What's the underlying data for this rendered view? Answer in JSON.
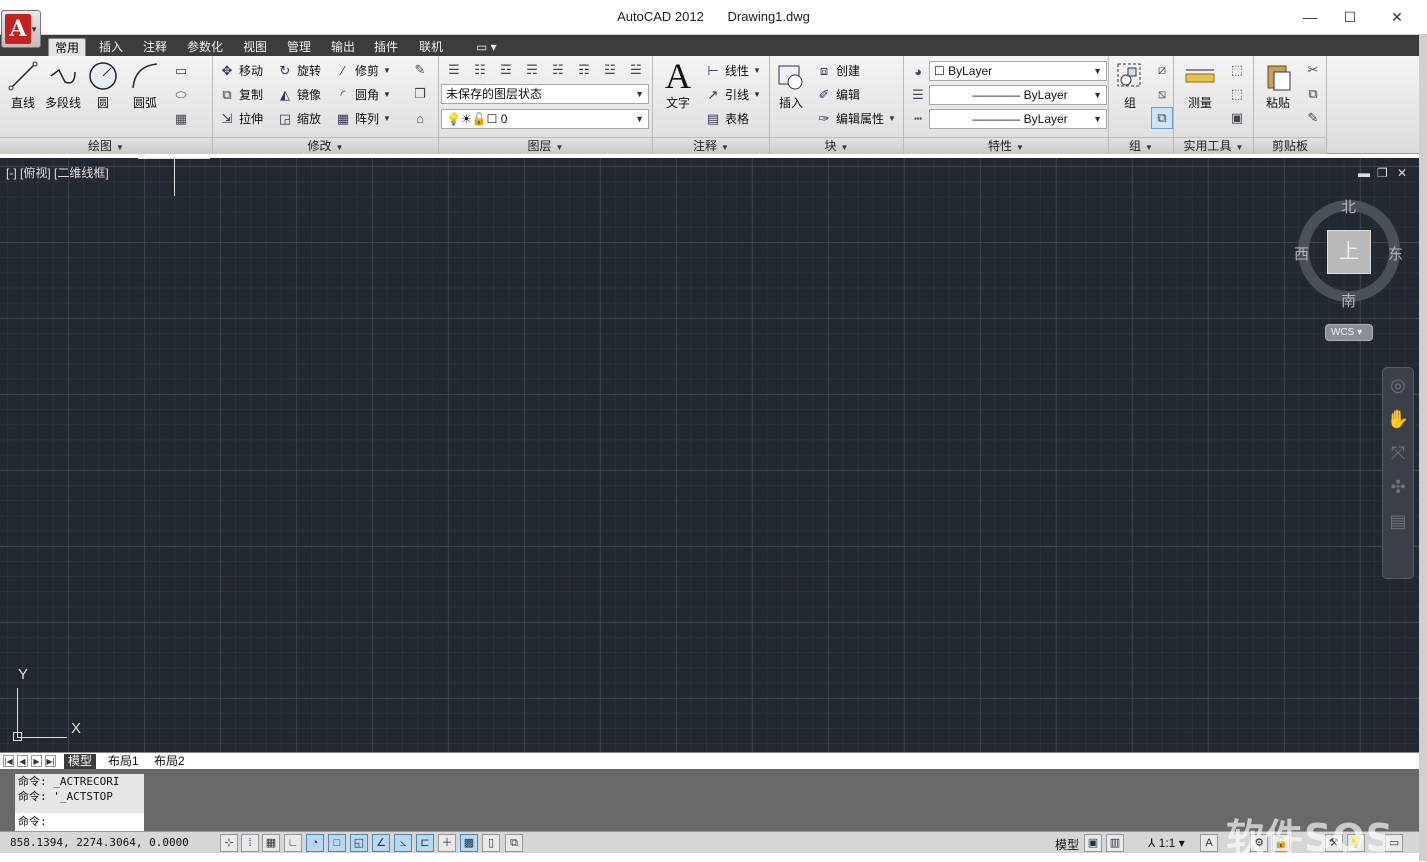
{
  "titlebar": {
    "app_name": "AutoCAD 2012",
    "file_name": "Drawing1.dwg",
    "logo_letter": "A",
    "minimize": "—",
    "maximize": "☐",
    "close": "✕"
  },
  "tabs": [
    "常用",
    "插入",
    "注释",
    "参数化",
    "视图",
    "管理",
    "输出",
    "插件",
    "联机"
  ],
  "draw_panel": {
    "title": "绘图",
    "line": "直线",
    "polyline": "多段线",
    "circle": "圆",
    "arc": "圆弧"
  },
  "modify_panel": {
    "title": "修改",
    "move": "移动",
    "rotate": "旋转",
    "trim": "修剪",
    "copy": "复制",
    "mirror": "镜像",
    "fillet": "圆角",
    "stretch": "拉伸",
    "scale": "缩放",
    "array": "阵列"
  },
  "layers_panel": {
    "title": "图层",
    "layer_state": "未保存的图层状态",
    "current_layer": "0"
  },
  "annotation_panel": {
    "title": "注释",
    "text": "文字",
    "linear": "线性",
    "leader": "引线",
    "table": "表格"
  },
  "block_panel": {
    "title": "块",
    "insert": "插入",
    "create": "创建",
    "edit": "编辑",
    "edit_attributes": "编辑属性"
  },
  "properties_panel": {
    "title": "特性",
    "color": "ByLayer",
    "lineweight": "ByLayer",
    "linetype": "ByLayer"
  },
  "groups_panel": {
    "title": "组",
    "group": "组"
  },
  "utilities_panel": {
    "title": "实用工具",
    "measure": "测量"
  },
  "clipboard_panel": {
    "title": "剪贴板",
    "paste": "粘贴"
  },
  "viewport": {
    "label": "[-] [俯视] [二维线框]",
    "viewcube": {
      "top_face": "上",
      "north": "北",
      "south": "南",
      "east": "东",
      "west": "西",
      "wcs": "WCS"
    },
    "ucs": {
      "x": "X",
      "y": "Y"
    }
  },
  "layout_tabs": [
    "模型",
    "布局1",
    "布局2"
  ],
  "command": {
    "history": [
      "命令: _ACTRECORI",
      "命令: '_ACTSTOP"
    ],
    "prompt": "命令:"
  },
  "status": {
    "coords": "858.1394,  2274.3064, 0.0000",
    "model": "模型",
    "scale": "1:1"
  },
  "watermark": "软件SOS",
  "colors": {
    "canvas": "#212830",
    "tabbar": "#3c3c3c",
    "command_bg": "#696969"
  }
}
